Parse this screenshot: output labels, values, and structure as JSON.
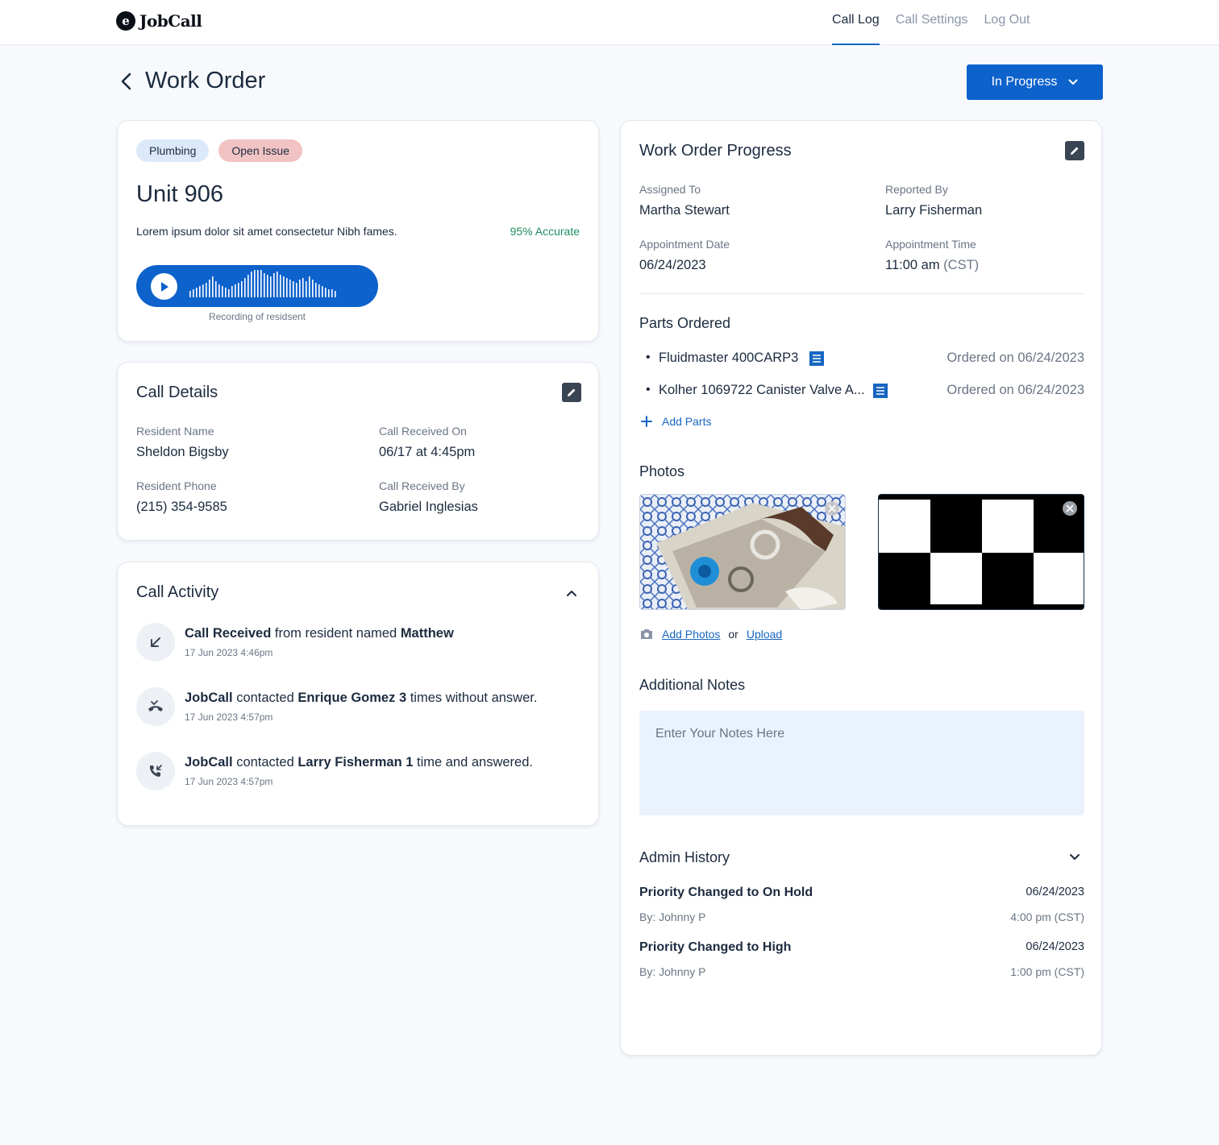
{
  "app": {
    "logo_text": "JobCall",
    "logo_mark": "e"
  },
  "nav": {
    "items": [
      "Call Log",
      "Call Settings",
      "Log Out"
    ]
  },
  "page": {
    "title": "Work Order",
    "status": "In Progress"
  },
  "summary": {
    "tags": [
      "Plumbing",
      "Open Issue"
    ],
    "unit": "Unit 906",
    "description": "Lorem ipsum dolor sit amet consectetur Nibh fames.",
    "accuracy": "95% Accurate",
    "recording_caption": "Recording of residsent"
  },
  "call_details": {
    "title": "Call Details",
    "resident_name_label": "Resident Name",
    "resident_name": "Sheldon Bigsby",
    "received_on_label": "Call Received On",
    "received_on": "06/17 at 4:45pm",
    "phone_label": "Resident Phone",
    "phone": "(215) 354-9585",
    "received_by_label": "Call Received By",
    "received_by": "Gabriel Inglesias"
  },
  "call_activity": {
    "title": "Call Activity",
    "items": [
      {
        "icon": "incoming-arrow-icon",
        "b1": "Call Received",
        "t1": " from resident named ",
        "b2": "Matthew",
        "t2": "",
        "time": "17 Jun 2023 4:46pm"
      },
      {
        "icon": "missed-call-icon",
        "b1": "JobCall",
        "t1": " contacted ",
        "b2": "Enrique Gomez 3",
        "t2": " times without answer.",
        "time": "17 Jun 2023 4:57pm"
      },
      {
        "icon": "answered-call-icon",
        "b1": "JobCall",
        "t1": " contacted ",
        "b2": "Larry Fisherman 1",
        "t2": " time and answered.",
        "time": "17 Jun 2023 4:57pm"
      }
    ]
  },
  "progress": {
    "title": "Work Order Progress",
    "assigned_to_label": "Assigned To",
    "assigned_to": "Martha Stewart",
    "reported_by_label": "Reported By",
    "reported_by": "Larry Fisherman",
    "appt_date_label": "Appointment Date",
    "appt_date": "06/24/2023",
    "appt_time_label": "Appointment Time",
    "appt_time": "11:00 am",
    "appt_tz": "(CST)"
  },
  "parts": {
    "title": "Parts Ordered",
    "items": [
      {
        "name": "Fluidmaster 400CARP3",
        "ordered": "Ordered on 06/24/2023"
      },
      {
        "name": "Kolher 1069722 Canister Valve A...",
        "ordered": "Ordered on 06/24/2023"
      }
    ],
    "add_label": "Add Parts"
  },
  "photos": {
    "title": "Photos",
    "add_label": "Add Photos",
    "or_label": "or",
    "upload_label": "Upload"
  },
  "notes": {
    "title": "Additional Notes",
    "placeholder": "Enter Your Notes Here"
  },
  "admin_history": {
    "title": "Admin History",
    "items": [
      {
        "title": "Priority Changed to On Hold",
        "date": "06/24/2023",
        "by": "By: Johnny P",
        "time": "4:00 pm (CST)"
      },
      {
        "title": "Priority Changed to High",
        "date": "06/24/2023",
        "by": "By: Johnny P",
        "time": "1:00 pm (CST)"
      }
    ]
  },
  "colors": {
    "accent": "#0d62cc",
    "link": "#1766c2",
    "success": "#1f8f5f",
    "tag_plumbing": "#dbe9fb",
    "tag_open": "#f1c3c3",
    "notes_bg": "#eaf2fd"
  }
}
